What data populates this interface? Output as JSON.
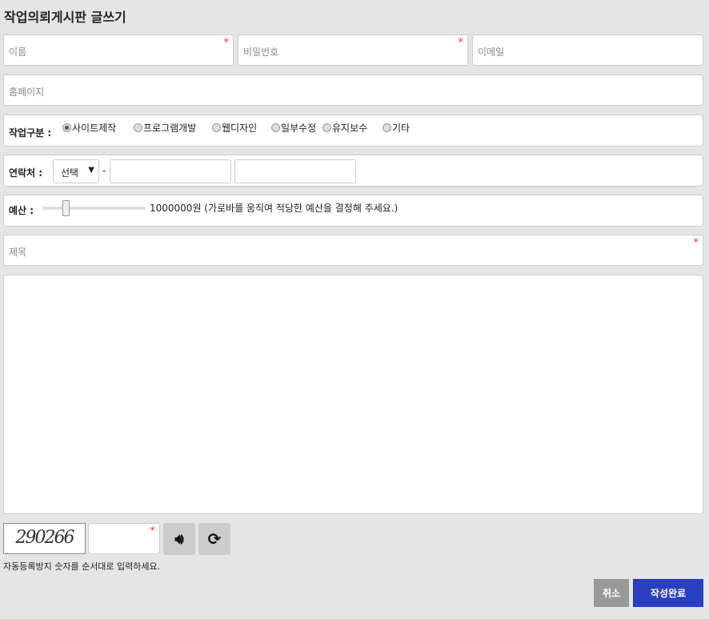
{
  "title": "작업의뢰게시판 글쓰기",
  "fields": {
    "name": "이름",
    "password": "비밀번호",
    "email": "이메일",
    "homepage": "홈페이지",
    "subject": "제목",
    "required_mark": "*"
  },
  "work_type": {
    "label": "작업구분 :",
    "options": [
      "사이트제작",
      "프로그램개발",
      "웹디자인",
      "일부수정",
      "유지보수",
      "기타"
    ],
    "selected": 0
  },
  "contact": {
    "label": "연락처 :",
    "select_value": "선택",
    "separator": "-"
  },
  "budget": {
    "label": "예산 :",
    "value_text": "1000000원 (가로바를 움직여 적당한 예산을 결정해 주세요.)",
    "slider_fraction": 0.22
  },
  "captcha": {
    "image_text": "290266",
    "hint": "자동등록방지 숫자를 순서대로 입력하세요."
  },
  "buttons": {
    "cancel": "취소",
    "submit": "작성완료"
  },
  "colors": {
    "submit": "#2a3fbf",
    "cancel": "#999999",
    "required": "#ee3333"
  }
}
